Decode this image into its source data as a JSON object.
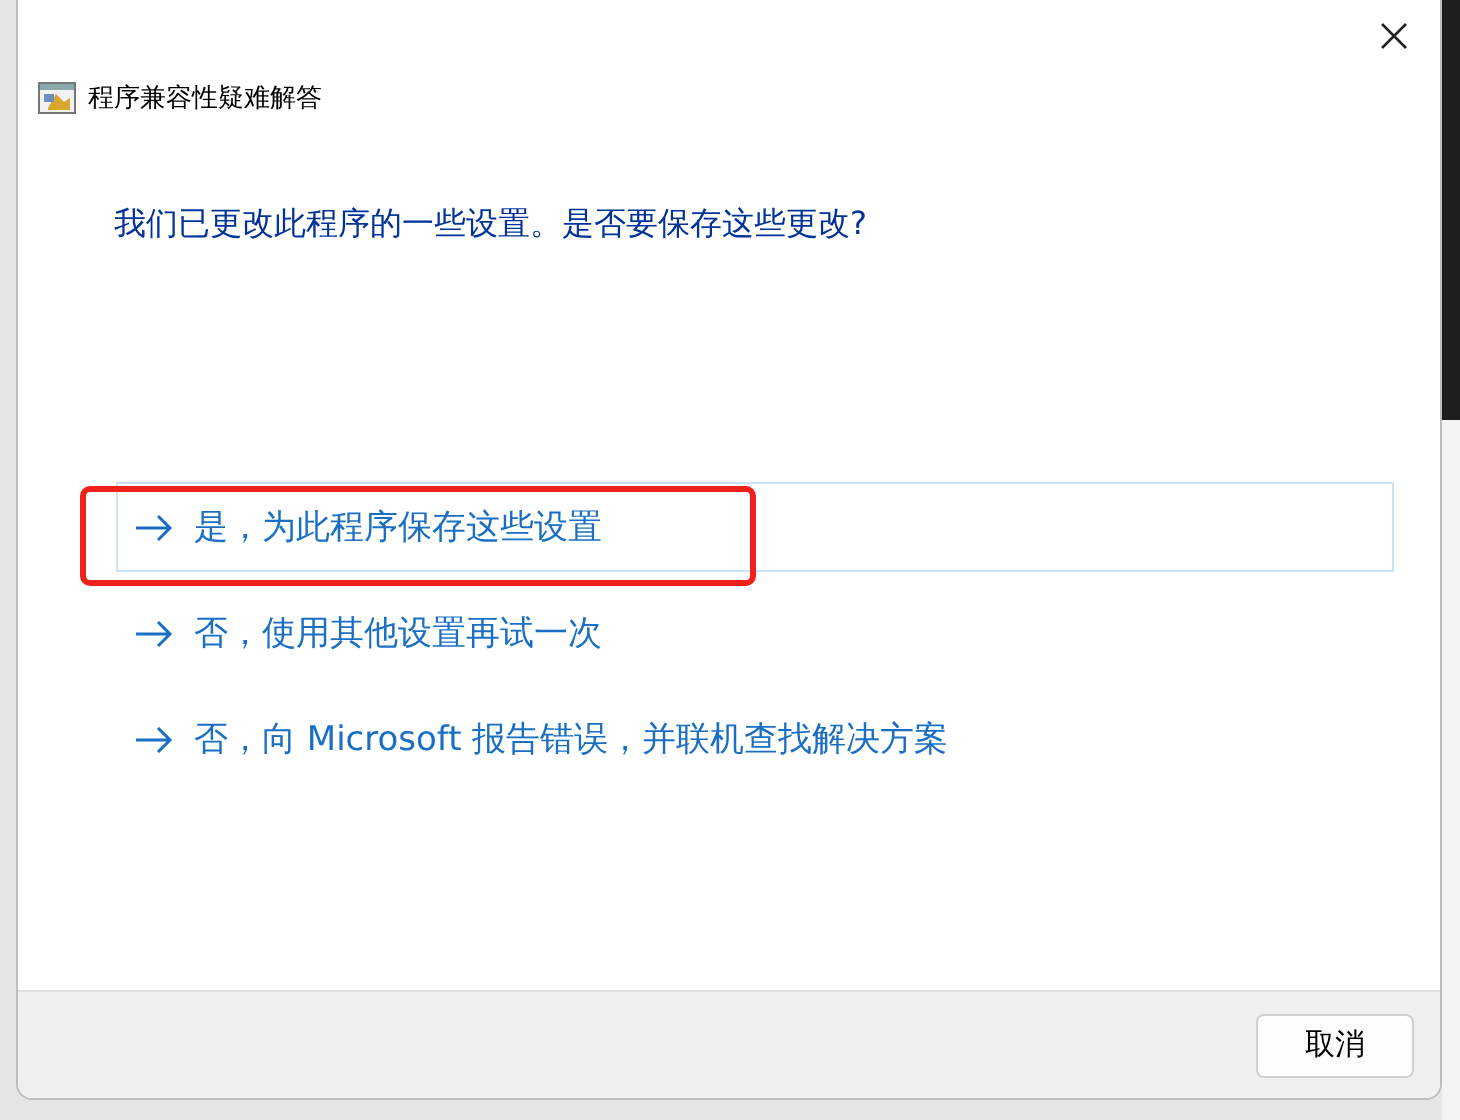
{
  "window": {
    "title": "程序兼容性疑难解答"
  },
  "question": "我们已更改此程序的一些设置。是否要保存这些更改?",
  "options": [
    {
      "label": "是，为此程序保存这些设置",
      "focused": true,
      "highlighted": true
    },
    {
      "label": "否，使用其他设置再试一次",
      "focused": false,
      "highlighted": false
    },
    {
      "label": "否，向 Microsoft 报告错误，并联机查找解决方案",
      "focused": false,
      "highlighted": false
    }
  ],
  "buttons": [
    "取消"
  ]
}
